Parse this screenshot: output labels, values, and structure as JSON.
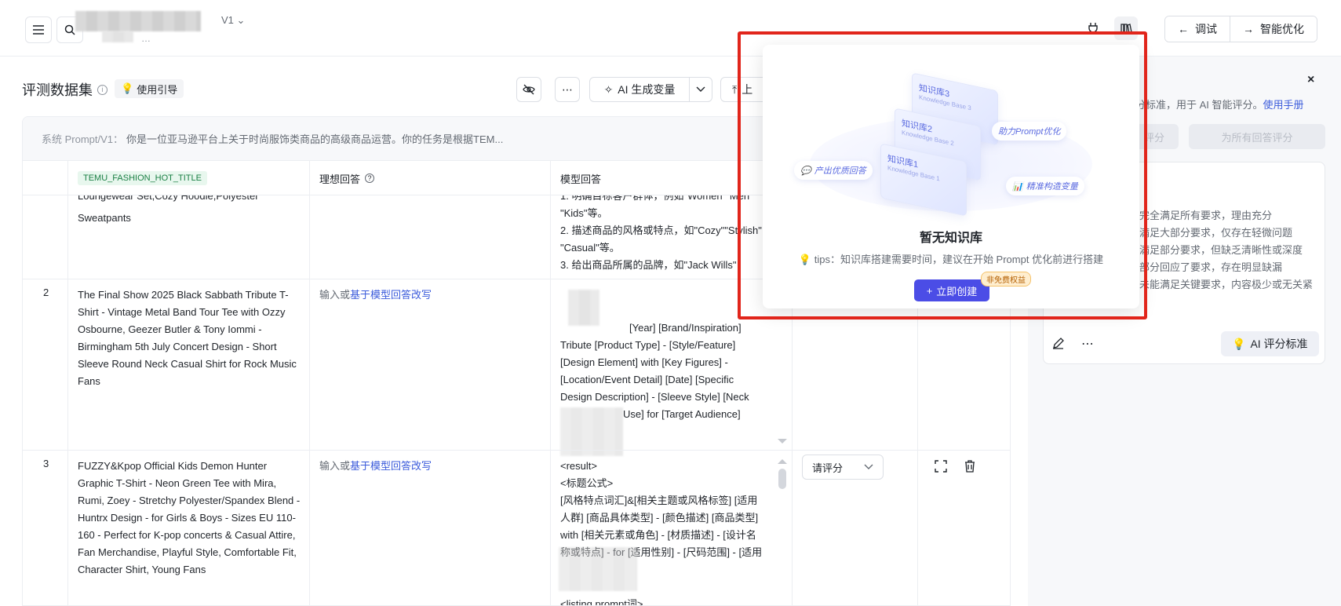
{
  "header": {
    "version": "V1",
    "subtitle": "…",
    "btn_debug": "调试",
    "btn_optimize": "智能优化"
  },
  "dataset": {
    "title": "评测数据集",
    "guide": "使用引导",
    "ai_gen_var": "AI 生成变量",
    "upload": "上"
  },
  "system_prompt": {
    "label": "系统 Prompt/V1：",
    "text": "你是一位亚马逊平台上关于时尚服饰类商品的高级商品运营。你的任务是根据TEM..."
  },
  "table": {
    "headers": [
      "TEMU_FASHION_HOT_TITLE",
      "理想回答",
      "模型回答"
    ],
    "row0": {
      "title_lines": [
        "Loungewear Set,Cozy Hoodie,Polyester",
        "Sweatpants"
      ],
      "answer_lines": [
        "1. 明确目标客户群体，例如\"Women\"\"Men\"",
        "\"Kids\"等。",
        "2. 描述商品的风格或特点，如\"Cozy\"\"Stylish\"",
        "\"Casual\"等。",
        "3. 给出商品所属的品牌，如\"Jack Wills\""
      ]
    },
    "row1": {
      "num": "2",
      "title": "The Final Show 2025 Black Sabbath Tribute T-Shirt - Vintage Metal Band Tour Tee with Ozzy Osbourne, Geezer Butler & Tony Iommi - Birmingham 5th July Concert Design - Short Sleeve Round Neck Casual Shirt for Rock Music Fans",
      "ideal_prefix": "输入或",
      "ideal_link": "基于模型回答改写",
      "answer_lines": [
        "[Year] [Brand/Inspiration]",
        "Tribute [Product Type] - [Style/Feature]",
        "[Design Element] with [Key Figures] -",
        "[Location/Event Detail] [Date] [Specific",
        "Design Description] - [Sleeve Style] [Neck",
        "Use] for [Target Audience]"
      ]
    },
    "row2": {
      "num": "3",
      "title": "FUZZY&Kpop Official Kids Demon Hunter Graphic T-Shirt - Neon Green Tee with Mira, Rumi, Zoey - Stretchy Polyester/Spandex Blend - Huntrx Design - for Girls & Boys - Sizes EU 110-160 - Perfect for K-pop concerts & Casual Attire, Fan Merchandise, Playful Style, Comfortable Fit, Character Shirt, Young Fans",
      "ideal_prefix": "输入或",
      "ideal_link": "基于模型回答改写",
      "answer_lines": [
        "<result>",
        "<标题公式>",
        "[风格特点词汇]&[相关主题或风格标签] [适用",
        "人群] [商品具体类型] - [颜色描述] [商品类型]",
        "with [相关元素或角色] - [材质描述] - [设计名",
        "称或特点] - for [适用性别] - [尺码范围] - [适用",
        "<listing prompt词>"
      ],
      "score_select": "请评分"
    }
  },
  "right_panel": {
    "desc_prefix": "分标准，用于 AI 智能评分。",
    "manual_link": "使用手册",
    "btn_score": "评分",
    "btn_score_all": "为所有回答评分",
    "criteria": [
      "完全满足所有要求，理由充分",
      "满足大部分要求，仅存在轻微问题",
      "满足部分要求，但缺乏清晰性或深度",
      "部分回应了要求，存在明显缺漏",
      "未能满足关键要求，内容极少或无关紧"
    ],
    "ai_std": "AI 评分标准"
  },
  "popup": {
    "title": "暂无知识库",
    "tip": "tips：知识库搭建需要时间，建议在开始 Prompt 优化前进行搭建",
    "create": "立即创建",
    "badge": "非免费权益",
    "chip1": "产出优质回答",
    "chip2": "助力Prompt优化",
    "chip3": "精准构造变量",
    "card1": "知识库1",
    "card2": "知识库2",
    "card3": "知识库3",
    "card_sub1": "Knowledge Base 1",
    "card_sub2": "Knowledge Base 2",
    "card_sub3": "Knowledge Base 3"
  },
  "colors": {
    "accent": "#4b4de6",
    "link": "#3b5bdb",
    "highlight_frame": "#e1251b"
  }
}
